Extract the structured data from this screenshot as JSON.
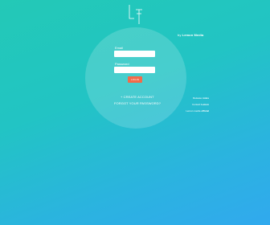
{
  "logo": {
    "icon": "brand-logo-icon"
  },
  "by_line": {
    "prefix": "by",
    "brand": "Lemon Media"
  },
  "form": {
    "email_label": "Email",
    "email_value": "",
    "email_placeholder": "",
    "password_label": "Password",
    "password_value": "",
    "password_placeholder": "",
    "login_label": "LOGIN"
  },
  "links": {
    "create_account": "+ CREATE ACCOUNT",
    "forgot_password": "FORGOT YOUR PASSWORD?"
  },
  "side_links": [
    {
      "prefix": "Release",
      "accent": "notes"
    },
    {
      "prefix": "Contact",
      "accent": "Lemon"
    },
    {
      "prefix": "Lemon media",
      "accent": "official"
    }
  ],
  "colors": {
    "background_start": "#23c9b6",
    "background_end": "#31a9ee",
    "button": "#f26b4a"
  }
}
